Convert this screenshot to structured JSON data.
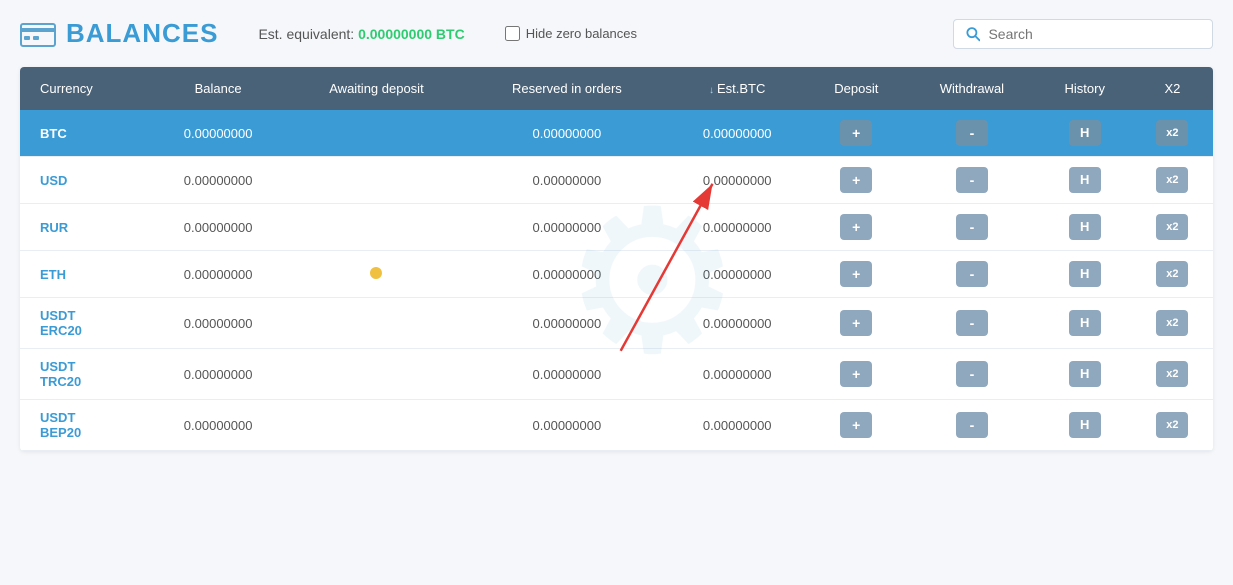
{
  "header": {
    "title": "BALANCES",
    "est_label": "Est. equivalent:",
    "est_value": "0.00000000 BTC",
    "hide_zero_label": "Hide zero balances",
    "search_placeholder": "Search"
  },
  "table": {
    "columns": [
      {
        "id": "currency",
        "label": "Currency"
      },
      {
        "id": "balance",
        "label": "Balance"
      },
      {
        "id": "awaiting_deposit",
        "label": "Awaiting deposit"
      },
      {
        "id": "reserved_in_orders",
        "label": "Reserved in orders"
      },
      {
        "id": "est_btc",
        "label": "Est.BTC",
        "sortable": true
      },
      {
        "id": "deposit",
        "label": "Deposit"
      },
      {
        "id": "withdrawal",
        "label": "Withdrawal"
      },
      {
        "id": "history",
        "label": "History"
      },
      {
        "id": "x2",
        "label": "X2"
      }
    ],
    "rows": [
      {
        "currency": "BTC",
        "balance": "0.00000000",
        "awaiting": "",
        "reserved": "0.00000000",
        "est_btc": "0.00000000",
        "active": true
      },
      {
        "currency": "USD",
        "balance": "0.00000000",
        "awaiting": "",
        "reserved": "0.00000000",
        "est_btc": "0.00000000",
        "active": false
      },
      {
        "currency": "RUR",
        "balance": "0.00000000",
        "awaiting": "",
        "reserved": "0.00000000",
        "est_btc": "0.00000000",
        "active": false
      },
      {
        "currency": "ETH",
        "balance": "0.00000000",
        "awaiting": "",
        "reserved": "0.00000000",
        "est_btc": "0.00000000",
        "active": false,
        "has_dot": true
      },
      {
        "currency": "USDT\nERC20",
        "balance": "0.00000000",
        "awaiting": "",
        "reserved": "0.00000000",
        "est_btc": "0.00000000",
        "active": false
      },
      {
        "currency": "USDT\nTRC20",
        "balance": "0.00000000",
        "awaiting": "",
        "reserved": "0.00000000",
        "est_btc": "0.00000000",
        "active": false
      },
      {
        "currency": "USDT\nBEP20",
        "balance": "0.00000000",
        "awaiting": "",
        "reserved": "0.00000000",
        "est_btc": "0.00000000",
        "active": false
      }
    ],
    "btn_labels": {
      "deposit": "+",
      "withdrawal": "-",
      "history": "H",
      "x2": "x2"
    }
  }
}
